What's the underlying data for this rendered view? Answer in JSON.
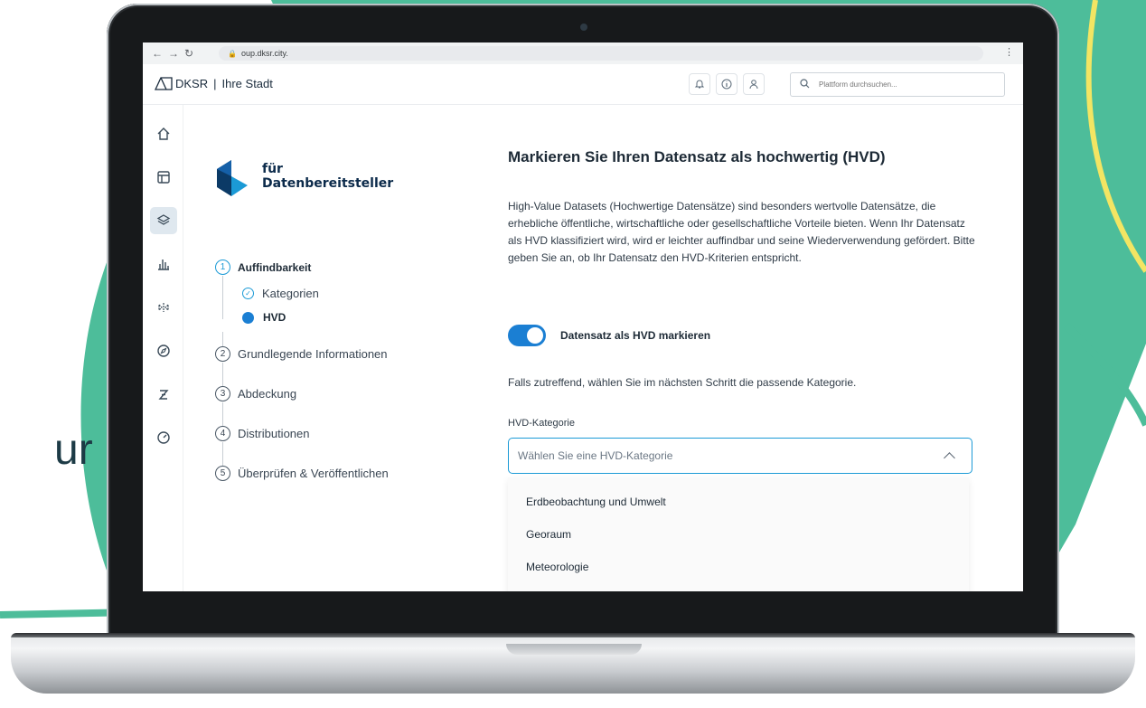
{
  "background": {
    "partial_text": "ur",
    "colors": {
      "green": "#4dbd9a",
      "yellow": "#f3e563",
      "dark": "#1d3b46"
    }
  },
  "browser": {
    "url": "oup.dksr.city.",
    "back_icon": "arrow-left-icon",
    "forward_icon": "arrow-right-icon",
    "reload_icon": "reload-icon",
    "menu_icon": "kebab-menu-icon"
  },
  "header": {
    "brand": "DKSR",
    "separator": "|",
    "city": "Ihre Stadt",
    "icons": [
      "bell-icon",
      "info-icon",
      "user-icon"
    ],
    "search_placeholder": "Plattform durchsuchen..."
  },
  "sidebar": {
    "items": [
      {
        "icon": "home-icon",
        "active": false
      },
      {
        "icon": "layout-icon",
        "active": false
      },
      {
        "icon": "layers-icon",
        "active": true
      },
      {
        "icon": "bar-chart-icon",
        "active": false
      },
      {
        "icon": "split-arrows-icon",
        "active": false
      },
      {
        "icon": "compass-icon",
        "active": false
      },
      {
        "icon": "z-icon",
        "active": false
      },
      {
        "icon": "gauge-icon",
        "active": false
      }
    ]
  },
  "wizard": {
    "brand_line1": "für",
    "brand_line2": "Datenbereitsteller",
    "steps": [
      {
        "num": "1",
        "label": "Auffindbarkeit",
        "active": true,
        "substeps": [
          {
            "label": "Kategorien",
            "state": "done"
          },
          {
            "label": "HVD",
            "state": "current"
          }
        ]
      },
      {
        "num": "2",
        "label": "Grundlegende Informationen"
      },
      {
        "num": "3",
        "label": "Abdeckung"
      },
      {
        "num": "4",
        "label": "Distributionen"
      },
      {
        "num": "5",
        "label": "Überprüfen & Veröffentlichen"
      }
    ]
  },
  "main": {
    "title": "Markieren Sie Ihren Datensatz als hochwertig (HVD)",
    "description": "High-Value Datasets (Hochwertige Datensätze) sind besonders wertvolle Datensätze, die erhebliche öffentliche, wirtschaftliche oder gesellschaftliche Vorteile bieten. Wenn Ihr Datensatz als HVD klassifiziert wird, wird er leichter auffindbar und seine Wiederverwendung gefördert. Bitte geben Sie an, ob Ihr Datensatz den HVD-Kriterien entspricht.",
    "toggle_label": "Datensatz als HVD markieren",
    "toggle_on": true,
    "hint": "Falls zutreffend, wählen Sie im nächsten Schritt die passende Kategorie.",
    "field_label": "HVD-Kategorie",
    "select_placeholder": "Wählen Sie eine HVD-Kategorie",
    "options": [
      "Erdbeobachtung und Umwelt",
      "Georaum",
      "Meteorologie"
    ],
    "accent": "#1b7fd3"
  }
}
